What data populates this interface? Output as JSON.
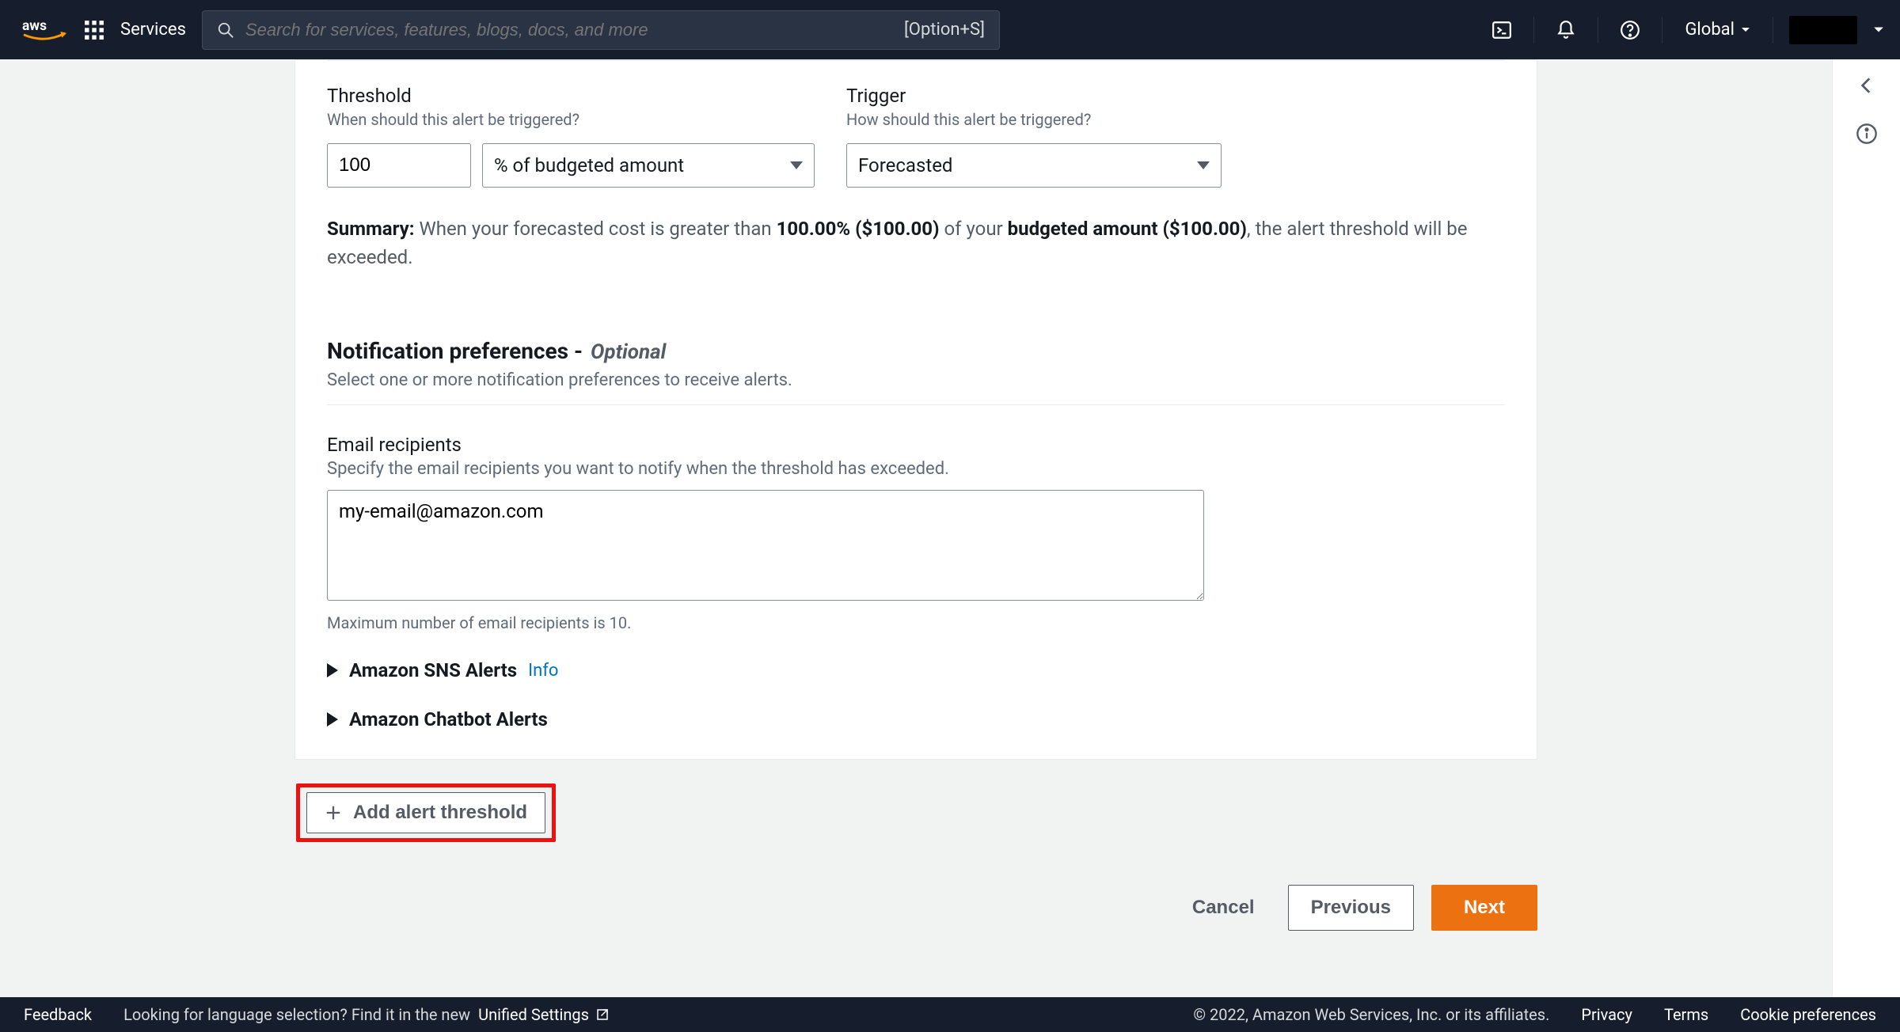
{
  "nav": {
    "services_label": "Services",
    "search_placeholder": "Search for services, features, blogs, docs, and more",
    "search_kbd": "[Option+S]",
    "region": "Global"
  },
  "threshold": {
    "label": "Threshold",
    "help": "When should this alert be triggered?",
    "value": "100",
    "unit": "% of budgeted amount"
  },
  "trigger": {
    "label": "Trigger",
    "help": "How should this alert be triggered?",
    "value": "Forecasted"
  },
  "summary": {
    "prefix": "Summary:",
    "s1": " When your forecasted cost is greater than ",
    "pct": "100.00% ($100.00)",
    "s2": " of your ",
    "ba": "budgeted amount ($100.00)",
    "s3": ", the alert threshold will be exceeded."
  },
  "notif": {
    "title": "Notification preferences -",
    "optional": "Optional",
    "subtitle": "Select one or more notification preferences to receive alerts."
  },
  "email": {
    "label": "Email recipients",
    "help": "Specify the email recipients you want to notify when the threshold has exceeded.",
    "value": "my-email@amazon.com",
    "limit": "Maximum number of email recipients is 10."
  },
  "expanders": {
    "sns": "Amazon SNS Alerts",
    "sns_info": "Info",
    "chatbot": "Amazon Chatbot Alerts"
  },
  "add_btn": "Add alert threshold",
  "buttons": {
    "cancel": "Cancel",
    "previous": "Previous",
    "next": "Next"
  },
  "footer": {
    "feedback": "Feedback",
    "lang1": "Looking for language selection? Find it in the new ",
    "unified": "Unified Settings",
    "copyright": "© 2022, Amazon Web Services, Inc. or its affiliates.",
    "privacy": "Privacy",
    "terms": "Terms",
    "cookie": "Cookie preferences"
  }
}
